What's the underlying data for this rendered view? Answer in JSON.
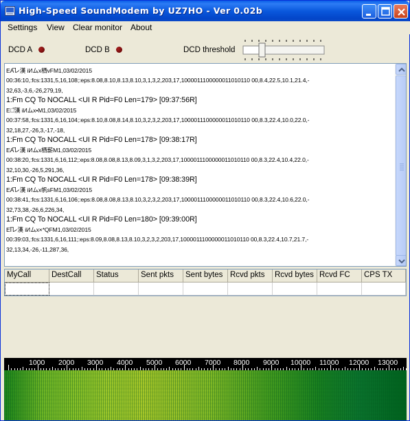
{
  "window": {
    "title": "High-Speed SoundModem by UZ7HO - Ver 0.02b",
    "buttons": [
      "minimize",
      "maximize",
      "close"
    ]
  },
  "menu": {
    "items": [
      {
        "label": "Settings"
      },
      {
        "label": "View"
      },
      {
        "label": "Clear monitor"
      },
      {
        "label": "About"
      }
    ]
  },
  "status": {
    "dcd_a_label": "DCD A",
    "dcd_b_label": "DCD B",
    "dcd_threshold_label": "DCD threshold",
    "led_color": "#8b0000"
  },
  "monitor": {
    "lines": [
      {
        "text": "EА̅̅レ漢 іИムх栖vFM1,03/02/2015",
        "hdr": false
      },
      {
        "text": "00:36:10,:fcs:1331,5,16,108;:eps:8.08,8.10,8.13,8.10,3,1,3,2,203,17,1000011100000011010110 00,8.4,22.5,10.1,21.4,-",
        "hdr": false
      },
      {
        "text": "32,63,-3,6,-26,279,19,",
        "hdr": false
      },
      {
        "text": "1:Fm CQ To NOCALL <UI R Pid=F0 Len=179> [09:37:56R]",
        "hdr": true
      },
      {
        "text": "Eヴ̅̅漢 іИムх•M1,03/02/2015",
        "hdr": false
      },
      {
        "text": "00:37:58,:fcs:1331,6,16,104;:eps:8.10,8.08,8.14,8.10,3,2,3,2,203,17,1000011100000011010110 00,8.3,22.4,10.0,22.0,-",
        "hdr": false
      },
      {
        "text": "32,18,27,-26,3,-17,-18,",
        "hdr": false
      },
      {
        "text": "1:Fm CQ To NOCALL <UI R Pid=F0 Len=178> [09:38:17R]",
        "hdr": true
      },
      {
        "text": "EА̅̅レ漢 іИムх栖薪M1,03/02/2015",
        "hdr": false
      },
      {
        "text": "00:38:20,:fcs:1331,6,16,112;:eps:8.08,8.08,8.13,8.09,3,1,3,2,203,17,1000011100000011010110 00,8.3,22.4,10.4,22.0,-",
        "hdr": false
      },
      {
        "text": "32,10,30,-26,5,291,36,",
        "hdr": false
      },
      {
        "text": "1:Fm CQ To NOCALL <UI R Pid=F0 Len=178> [09:38:39R]",
        "hdr": true
      },
      {
        "text": "EА̅̅レ漢 іИムх帆sFM1,03/02/2015",
        "hdr": false
      },
      {
        "text": "00:38:41,:fcs:1331,6,16,106;:eps:8.08,8.08,8.13,8.10,3,2,3,2,203,17,1000011100000011010110 00,8.3,22.4,10.6,22.0,-",
        "hdr": false
      },
      {
        "text": "32,73,38,-26,6,226,34,",
        "hdr": false
      },
      {
        "text": "1:Fm CQ To NOCALL <UI R Pid=F0 Len=180> [09:39:00R]",
        "hdr": true
      },
      {
        "text": "EΙ̅̅レ漢 іИムх×*QFM1,03/02/2015",
        "hdr": false
      },
      {
        "text": "00:39:03,:fcs:1331,6,16,111;:eps:8.09,8.08,8.13,8.10,3,2,3,2,203,17,1000011100000011010110 00,8.3,22.4,10.7,21.7,-",
        "hdr": false
      },
      {
        "text": "32,13,34,-26,-11,287,36,",
        "hdr": false
      }
    ]
  },
  "table": {
    "columns": [
      "MyCall",
      "DestCall",
      "Status",
      "Sent pkts",
      "Sent bytes",
      "Rcvd pkts",
      "Rcvd bytes",
      "Rcvd FC",
      "CPS TX"
    ]
  },
  "spectrum": {
    "freq_labels": [
      "1000",
      "2000",
      "3000",
      "4000",
      "5000",
      "6000",
      "7000",
      "8000",
      "9000",
      "10000",
      "11000",
      "12000",
      "13000"
    ]
  }
}
